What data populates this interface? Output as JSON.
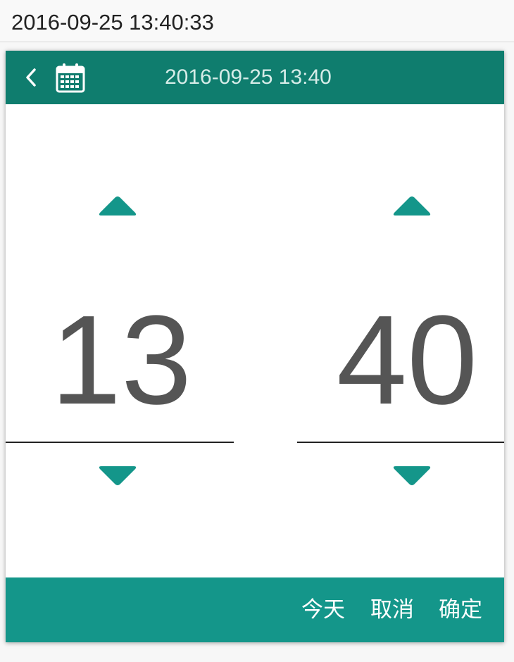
{
  "input": {
    "value": "2016-09-25 13:40:33"
  },
  "picker": {
    "header": {
      "title": "2016-09-25 13:40",
      "back_icon": "chevron-left-icon",
      "calendar_icon": "calendar-icon"
    },
    "hour": {
      "value": "13"
    },
    "minute": {
      "value": "40"
    },
    "footer": {
      "today_label": "今天",
      "cancel_label": "取消",
      "confirm_label": "确定"
    }
  },
  "colors": {
    "header_bg": "#0f7d6e",
    "footer_bg": "#14968a",
    "arrow": "#14968a",
    "number": "#555555"
  }
}
